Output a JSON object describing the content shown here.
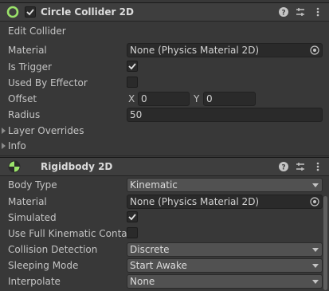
{
  "circle_collider": {
    "title": "Circle Collider 2D",
    "enabled": true,
    "edit_collider_label": "Edit Collider",
    "material_label": "Material",
    "material_value": "None (Physics Material 2D)",
    "is_trigger_label": "Is Trigger",
    "is_trigger": true,
    "used_by_effector_label": "Used By Effector",
    "used_by_effector": false,
    "offset_label": "Offset",
    "offset_x_label": "X",
    "offset_x": "0",
    "offset_y_label": "Y",
    "offset_y": "0",
    "radius_label": "Radius",
    "radius": "50",
    "layer_overrides_label": "Layer Overrides",
    "info_label": "Info"
  },
  "rigidbody": {
    "title": "Rigidbody 2D",
    "body_type_label": "Body Type",
    "body_type": "Kinematic",
    "material_label": "Material",
    "material_value": "None (Physics Material 2D)",
    "simulated_label": "Simulated",
    "simulated": true,
    "use_full_kinematic_label": "Use Full Kinematic Contac",
    "use_full_kinematic": false,
    "collision_detection_label": "Collision Detection",
    "collision_detection": "Discrete",
    "sleeping_mode_label": "Sleeping Mode",
    "sleeping_mode": "Start Awake",
    "interpolate_label": "Interpolate",
    "interpolate": "None"
  },
  "colors": {
    "background": "#383838",
    "header": "#3e3e3e",
    "collider_green": "#9be36a",
    "checkmark": "#e0e0e0"
  },
  "icons": [
    "circle-collider-icon",
    "checkbox-icon",
    "help-icon",
    "presets-icon",
    "more-icon",
    "rigidbody-icon",
    "object-picker-icon",
    "chevron-down-icon"
  ]
}
